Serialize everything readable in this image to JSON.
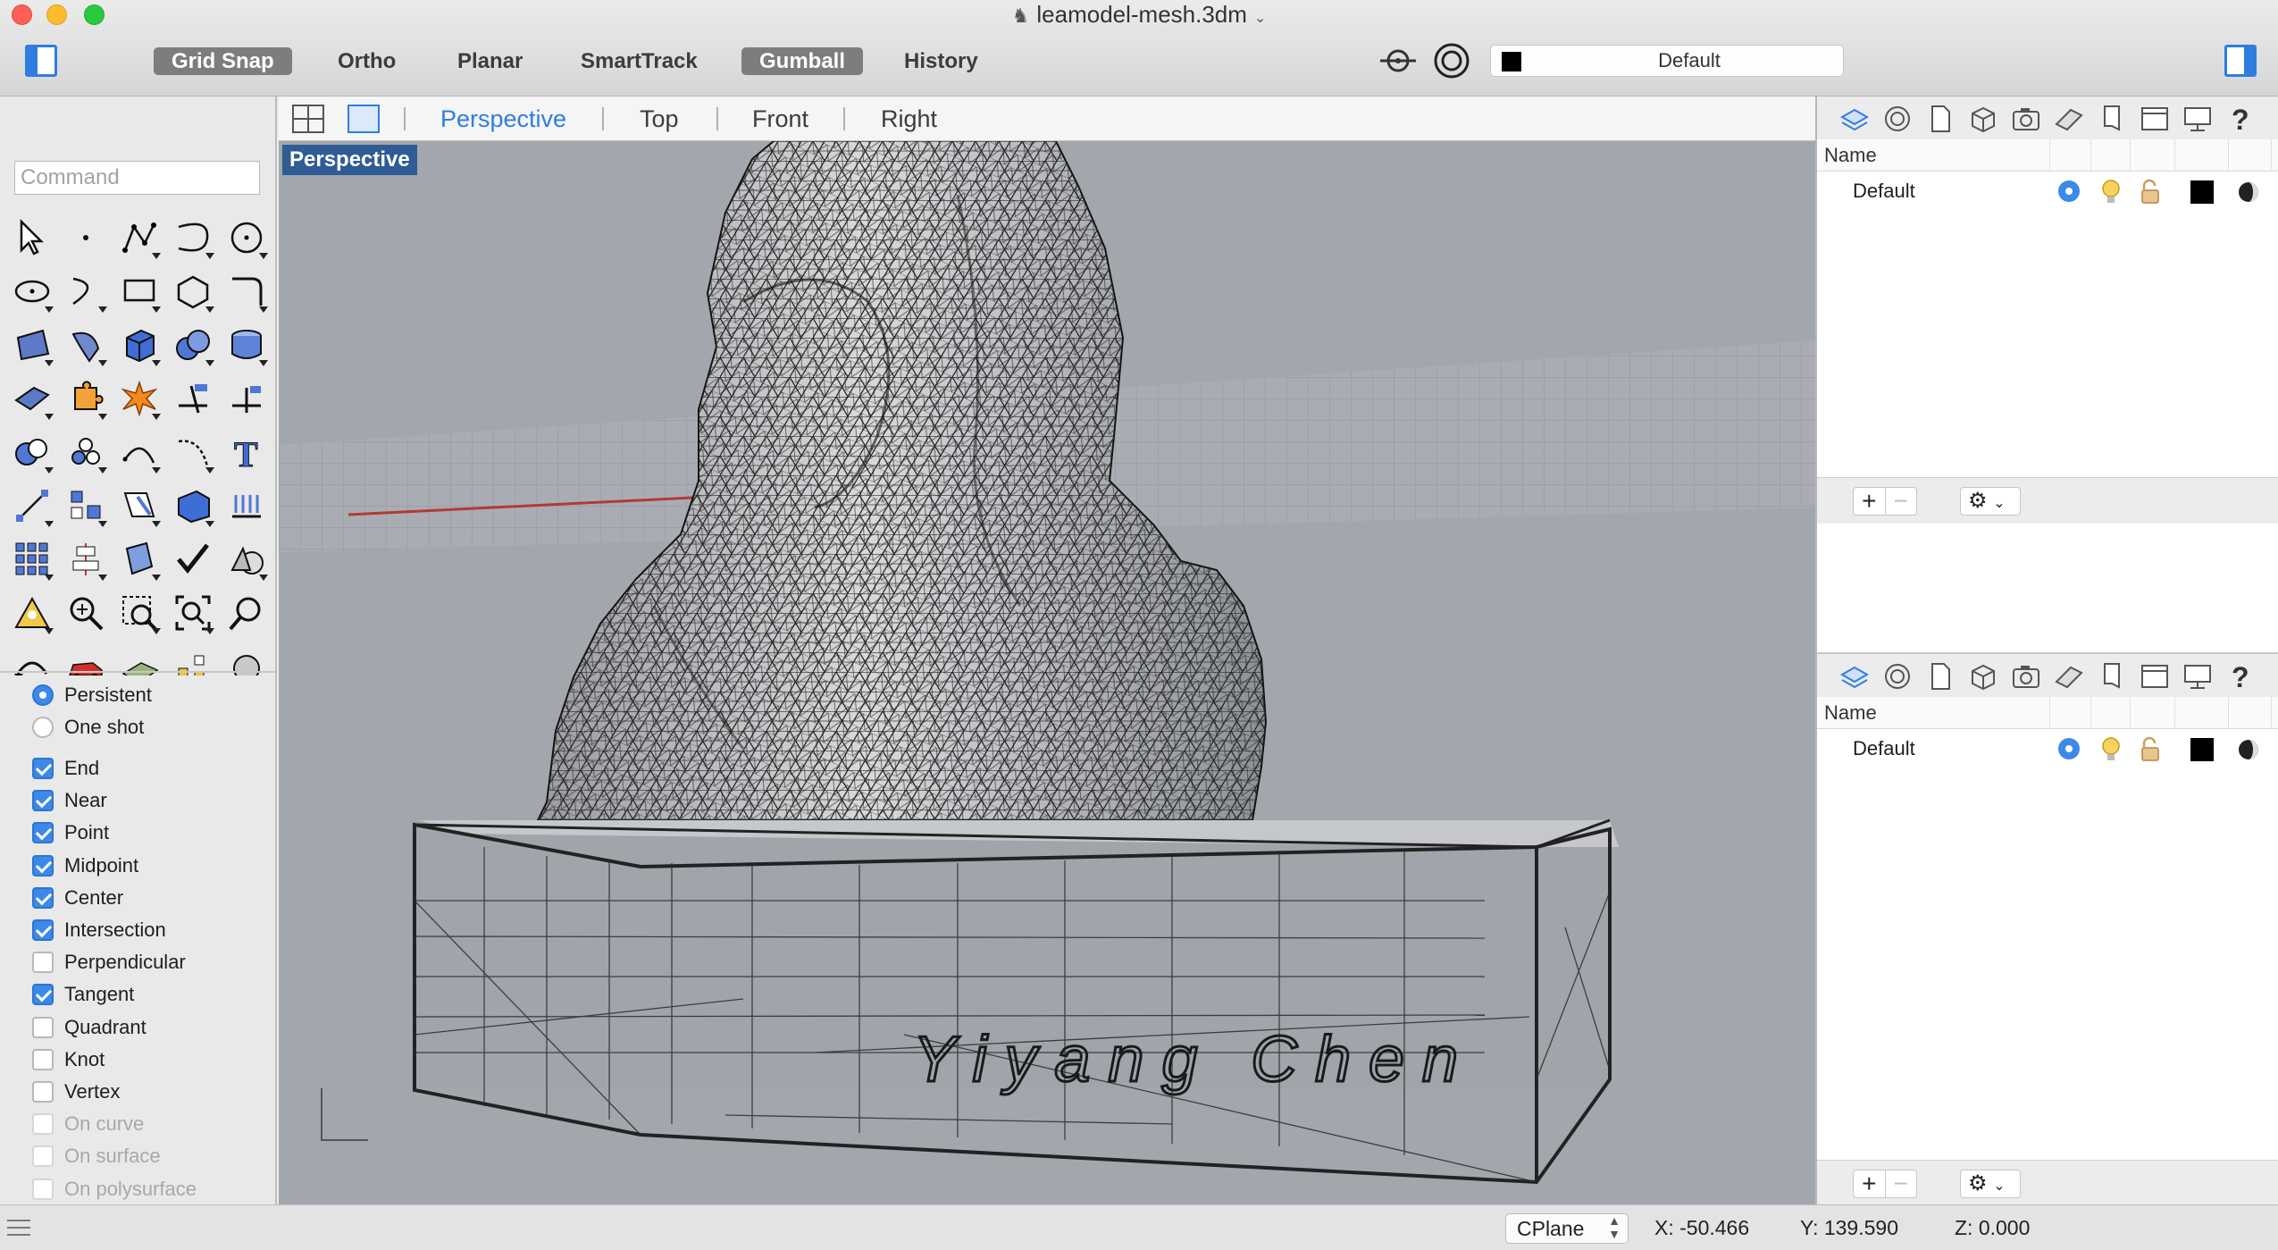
{
  "window": {
    "title": "leamodel-mesh.3dm"
  },
  "toolbar": {
    "modes": [
      {
        "label": "Grid Snap",
        "active": true
      },
      {
        "label": "Ortho",
        "active": false
      },
      {
        "label": "Planar",
        "active": false
      },
      {
        "label": "SmartTrack",
        "active": false
      },
      {
        "label": "Gumball",
        "active": true
      },
      {
        "label": "History",
        "active": false
      }
    ],
    "current_layer": "Default",
    "current_layer_color": "#000000"
  },
  "command": {
    "placeholder": "Command",
    "value": ""
  },
  "tools": [
    "select-arrow",
    "point",
    "polyline",
    "curve",
    "circle",
    "ellipse",
    "arc",
    "rectangle",
    "polygon",
    "fillet-curve",
    "surface-from-points",
    "extrude-surface",
    "box",
    "spheres",
    "cylinder",
    "patch-surface",
    "puzzle",
    "explode",
    "trim",
    "split",
    "boolean",
    "points-group",
    "offset",
    "rebuild-curve",
    "text",
    "move",
    "group",
    "draft-angle",
    "solid-box",
    "array-lines",
    "array-grid",
    "align",
    "extrude-mesh",
    "check",
    "render-objects",
    "analysis-cone",
    "zoom",
    "zoom-window",
    "zoom-extents",
    "magnifier",
    "rotate-view",
    "car",
    "mesh-surface",
    "lights",
    "render-sphere"
  ],
  "osnap": {
    "mode_options": [
      {
        "label": "Persistent",
        "selected": true
      },
      {
        "label": "One shot",
        "selected": false
      }
    ],
    "snaps": [
      {
        "label": "End",
        "checked": true,
        "enabled": true
      },
      {
        "label": "Near",
        "checked": true,
        "enabled": true
      },
      {
        "label": "Point",
        "checked": true,
        "enabled": true
      },
      {
        "label": "Midpoint",
        "checked": true,
        "enabled": true
      },
      {
        "label": "Center",
        "checked": true,
        "enabled": true
      },
      {
        "label": "Intersection",
        "checked": true,
        "enabled": true
      },
      {
        "label": "Perpendicular",
        "checked": false,
        "enabled": true
      },
      {
        "label": "Tangent",
        "checked": true,
        "enabled": true
      },
      {
        "label": "Quadrant",
        "checked": false,
        "enabled": true
      },
      {
        "label": "Knot",
        "checked": false,
        "enabled": true
      },
      {
        "label": "Vertex",
        "checked": false,
        "enabled": true
      },
      {
        "label": "On curve",
        "checked": false,
        "enabled": false
      },
      {
        "label": "On surface",
        "checked": false,
        "enabled": false
      },
      {
        "label": "On polysurface",
        "checked": false,
        "enabled": false
      }
    ]
  },
  "viewports": {
    "tabs": [
      {
        "label": "Perspective",
        "active": true
      },
      {
        "label": "Top",
        "active": false
      },
      {
        "label": "Front",
        "active": false
      },
      {
        "label": "Right",
        "active": false
      }
    ],
    "active_label": "Perspective",
    "model_engraving": "Yiyang Chen"
  },
  "layers_panels": [
    {
      "header_name": "Name",
      "layers": [
        {
          "name": "Default",
          "current": true,
          "color": "#000000"
        }
      ],
      "add_label": "+",
      "remove_label": "−"
    },
    {
      "header_name": "Name",
      "layers": [
        {
          "name": "Default",
          "current": true,
          "color": "#000000"
        }
      ],
      "add_label": "+",
      "remove_label": "−"
    }
  ],
  "statusbar": {
    "cplane": "CPlane",
    "x": "X: -50.466",
    "y": "Y: 139.590",
    "z": "Z: 0.000"
  },
  "colors": {
    "accent": "#2f7de1",
    "viewport_bg": "#a2a7ae",
    "label_bg": "#2f5c94"
  }
}
